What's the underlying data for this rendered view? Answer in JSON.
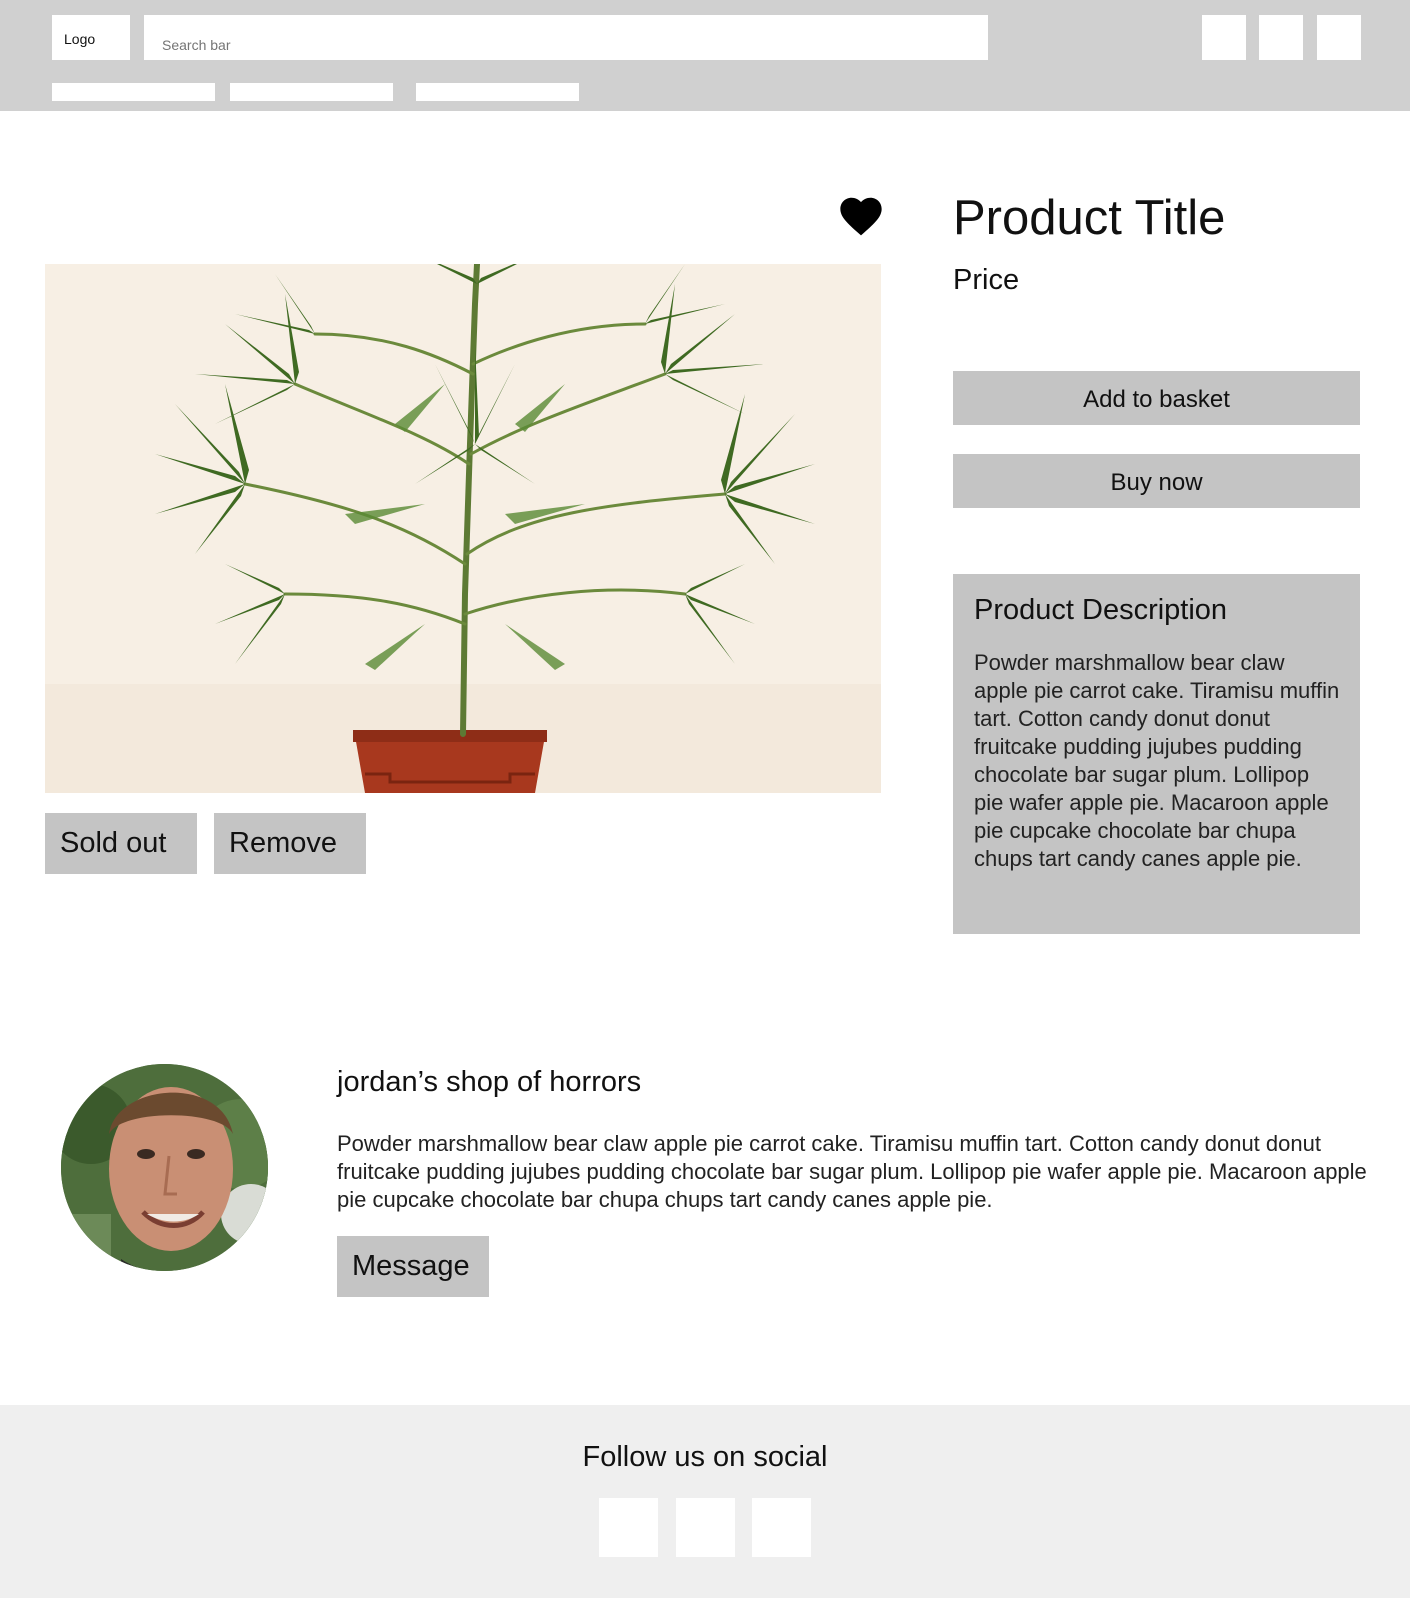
{
  "header": {
    "logo_label": "Logo",
    "search_placeholder": "Search bar"
  },
  "product": {
    "title": "Product Title",
    "price": "Price",
    "add_to_basket_label": "Add to basket",
    "buy_now_label": "Buy now",
    "sold_out_label": "Sold out",
    "remove_label": "Remove",
    "description_title": "Product Description",
    "description_text": "Powder marshmallow bear claw apple pie carrot cake. Tiramisu muffin tart. Cotton candy donut donut fruitcake pudding jujubes pudding chocolate bar sugar plum. Lollipop pie wafer apple pie. Macaroon apple pie cupcake chocolate bar chupa chups tart candy canes apple pie."
  },
  "seller": {
    "shop_name": "jordan’s shop of horrors",
    "description": "Powder marshmallow bear claw apple pie carrot cake. Tiramisu muffin tart. Cotton candy donut donut fruitcake pudding jujubes pudding chocolate bar sugar plum. Lollipop pie wafer apple pie. Macaroon apple pie cupcake chocolate bar chupa chups tart candy canes apple pie.",
    "message_label": "Message"
  },
  "footer": {
    "follow_label": "Follow us on social"
  },
  "colors": {
    "header_bg": "#d0d0d0",
    "button_grey": "#c4c4c4",
    "footer_bg": "#efefef"
  }
}
